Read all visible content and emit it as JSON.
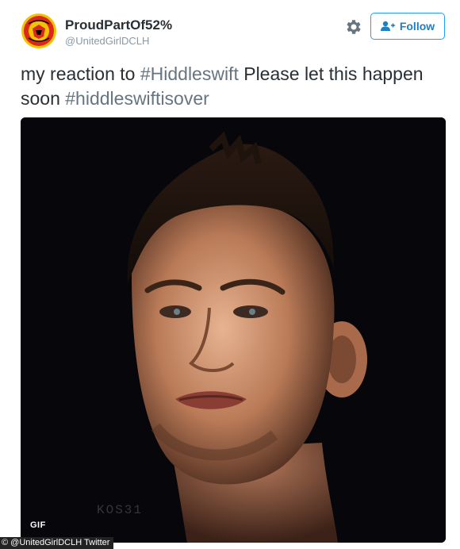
{
  "user": {
    "display_name": "ProudPartOf52%",
    "handle": "@UnitedGirlDCLH",
    "avatar_icon": "manchester-united-crest"
  },
  "actions": {
    "settings_icon": "gear-icon",
    "follow_label": "Follow",
    "follow_icon": "add-user-icon",
    "accent_color": "#1da1f2"
  },
  "tweet": {
    "text_before": "my reaction to ",
    "hashtag1": "#Hiddleswift",
    "text_middle": " Please let this happen soon ",
    "hashtag2": "#hiddleswiftisover"
  },
  "media": {
    "type": "animated GIF",
    "badge": "GIF",
    "watermark": "KOS31"
  },
  "credit": "© @UnitedGirlDCLH Twitter"
}
